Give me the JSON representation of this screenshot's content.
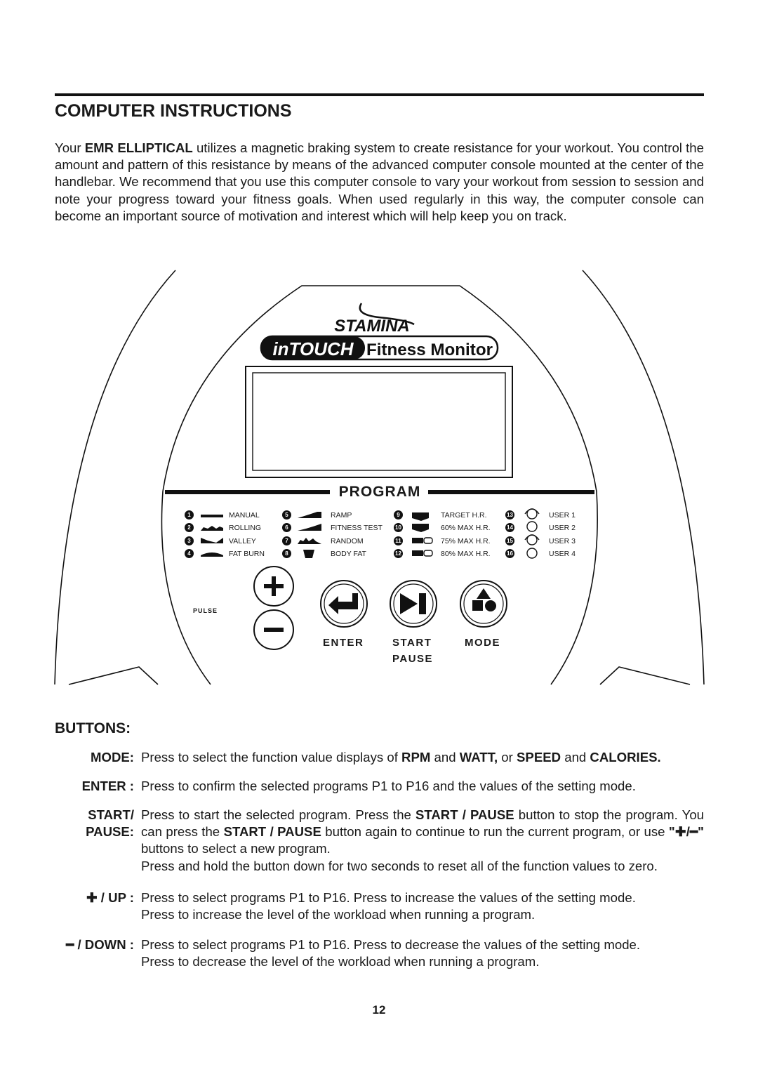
{
  "title": "COMPUTER INSTRUCTIONS",
  "intro": {
    "pre": "Your ",
    "brand": "EMR ELLIPTICAL",
    "text": " utilizes a magnetic braking system to create resistance for your workout.  You control the amount and pattern of this resistance by means of the advanced computer console mounted at the center of the handlebar.  We recommend that you use this computer console to vary your workout from session to session and note your progress toward your fitness goals.  When used regularly in this way, the computer console can become an important source of motivation and interest which will help keep you on track."
  },
  "console": {
    "logo_brand": "STAMINA",
    "logo_product": "inTOUCH Fitness Monitor",
    "program_title": "PROGRAM",
    "programs": [
      {
        "n": "1",
        "label": "MANUAL"
      },
      {
        "n": "2",
        "label": "ROLLING"
      },
      {
        "n": "3",
        "label": "VALLEY"
      },
      {
        "n": "4",
        "label": "FAT BURN"
      },
      {
        "n": "5",
        "label": "RAMP"
      },
      {
        "n": "6",
        "label": "FITNESS TEST"
      },
      {
        "n": "7",
        "label": "RANDOM"
      },
      {
        "n": "8",
        "label": "BODY FAT"
      },
      {
        "n": "9",
        "label": "TARGET H.R."
      },
      {
        "n": "10",
        "label": "60% MAX H.R."
      },
      {
        "n": "11",
        "label": "75% MAX H.R."
      },
      {
        "n": "12",
        "label": "80% MAX H.R."
      },
      {
        "n": "13",
        "label": "USER 1"
      },
      {
        "n": "14",
        "label": "USER 2"
      },
      {
        "n": "15",
        "label": "USER 3"
      },
      {
        "n": "16",
        "label": "USER 4"
      }
    ],
    "pulse": "PULSE",
    "enter": "ENTER",
    "start": "START",
    "pause": "PAUSE",
    "mode": "MODE"
  },
  "buttons_heading": "BUTTONS:",
  "buttons": {
    "mode": {
      "key": "MODE:",
      "t1": "Press to select the function value displays of ",
      "b1": "RPM",
      "t2": " and ",
      "b2": "WATT,",
      "t3": " or ",
      "b3": "SPEED",
      "t4": " and ",
      "b4": "CALORIES."
    },
    "enter": {
      "key": "ENTER :",
      "text": "Press to confirm the selected programs P1 to P16 and the values of the setting mode."
    },
    "start": {
      "key1": "START/",
      "key2": "PAUSE:",
      "t1": "Press to start the selected program.  Press the ",
      "b1": "START / PAUSE",
      "t2": " button to stop the program. You can press the ",
      "b2": "START / PAUSE",
      "t3": " button again to continue to run the current program, or use ",
      "b3": "\"✚/━\"",
      "t4": " buttons to select a new program.",
      "t5": "Press and hold the button down for two seconds to reset all of the function values to zero."
    },
    "up": {
      "key": "✚ / UP :",
      "l1": "Press to select programs P1 to P16.  Press to increase the values of the setting mode.",
      "l2": "Press to increase the level of the workload when running a program."
    },
    "down": {
      "key": "━ / DOWN :",
      "l1": "Press to select programs P1 to P16.  Press to decrease the values of the setting mode.",
      "l2": "Press to decrease the level of the workload when running a program."
    }
  },
  "page_number": "12"
}
